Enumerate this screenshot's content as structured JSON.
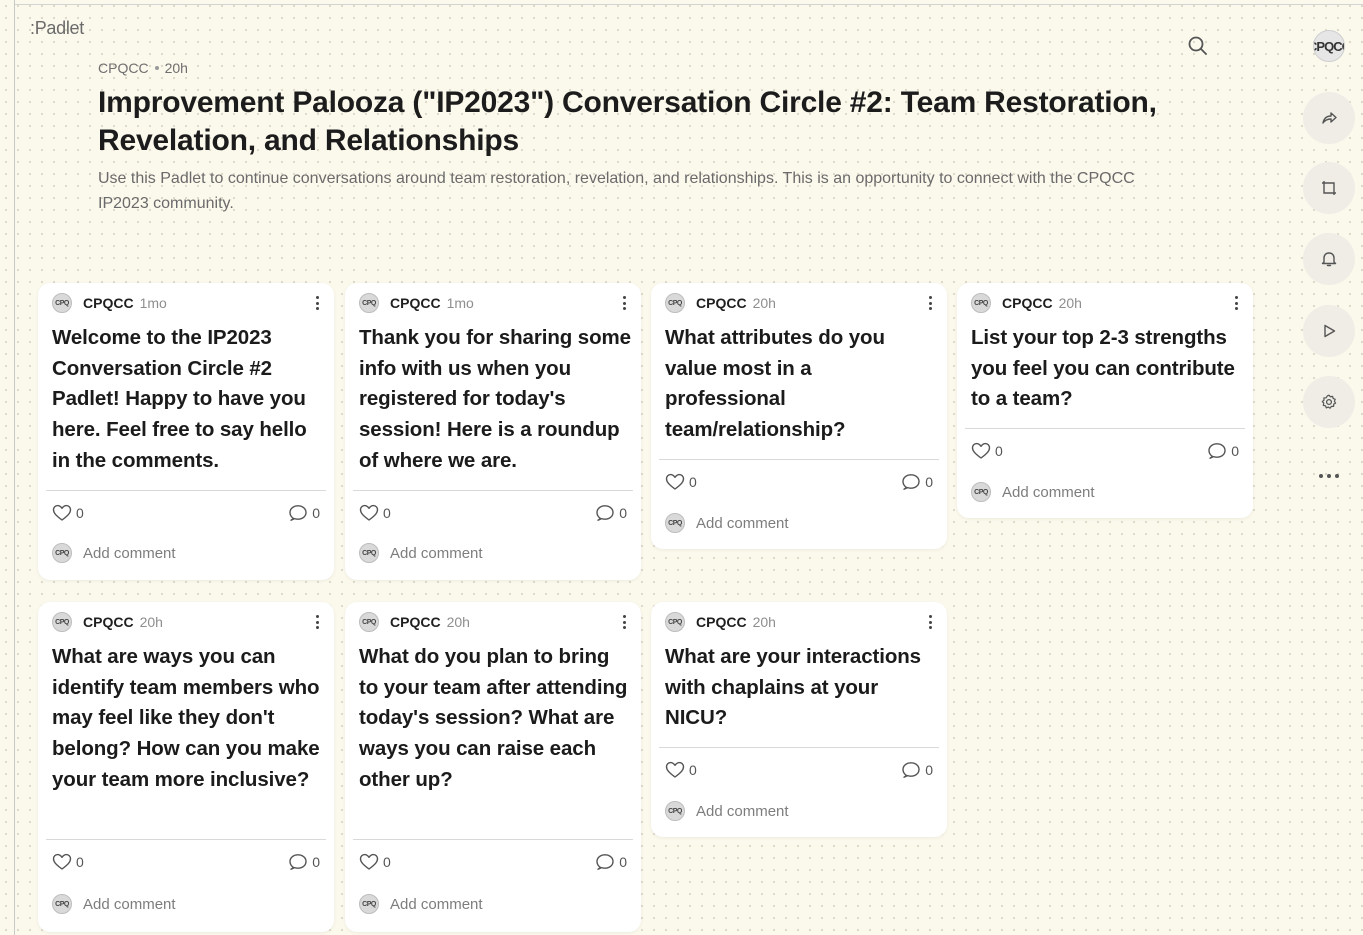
{
  "app": {
    "logo": ":Padlet"
  },
  "header": {
    "author": "CPQCC",
    "time": "20h",
    "title": "Improvement Palooza (\"IP2023\") Conversation Circle #2: Team Restoration, Revelation, and Relationships",
    "description": "Use this Padlet to continue conversations around team restoration, revelation, and relationships. This is an opportunity to connect with the CPQCC IP2023 community."
  },
  "rail": {
    "avatar_text": "CPQCC",
    "buttons": [
      "share-icon",
      "remake-icon",
      "bell-icon",
      "slideshow-icon",
      "settings-icon"
    ],
    "more_icon": "more-horizontal-icon"
  },
  "posts": [
    {
      "author": "CPQCC",
      "time": "1mo",
      "text": "Welcome to the IP2023 Conversation Circle #2 Padlet! Happy to have you here. Feel free to say hello in the comments.",
      "likes": "0",
      "comments": "0",
      "add_comment": "Add comment"
    },
    {
      "author": "CPQCC",
      "time": "1mo",
      "text": "Thank you for sharing some info with us when you registered for today's session! Here is a roundup of where we are.",
      "likes": "0",
      "comments": "0",
      "add_comment": "Add comment"
    },
    {
      "author": "CPQCC",
      "time": "20h",
      "text": "What attributes do you value most in a professional team/relationship?",
      "likes": "0",
      "comments": "0",
      "add_comment": "Add comment"
    },
    {
      "author": "CPQCC",
      "time": "20h",
      "text": "List your top 2-3 strengths you feel you can contribute to a team?",
      "likes": "0",
      "comments": "0",
      "add_comment": "Add comment"
    },
    {
      "author": "CPQCC",
      "time": "20h",
      "text": "What are ways you can identify team members who may feel like they don't belong? How can you make your team more inclusive?",
      "likes": "0",
      "comments": "0",
      "add_comment": "Add comment"
    },
    {
      "author": "CPQCC",
      "time": "20h",
      "text": "What do you plan to bring to your team after attending today's session? What are ways you can raise each other up?",
      "likes": "0",
      "comments": "0",
      "add_comment": "Add comment"
    },
    {
      "author": "CPQCC",
      "time": "20h",
      "text": "What are your interactions with chaplains at your NICU?",
      "likes": "0",
      "comments": "0",
      "add_comment": "Add comment"
    }
  ]
}
